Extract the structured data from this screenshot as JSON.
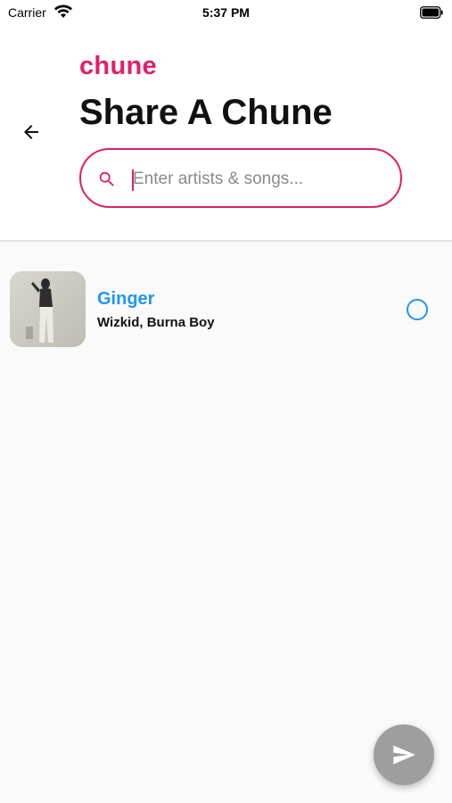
{
  "status_bar": {
    "carrier": "Carrier",
    "time": "5:37 PM"
  },
  "header": {
    "brand": "chune",
    "title": "Share A Chune",
    "back_icon": "arrow-left-icon"
  },
  "search": {
    "value": "",
    "placeholder": "Enter artists & songs...",
    "icon": "search-icon"
  },
  "results": [
    {
      "title": "Ginger",
      "artists": "Wizkid, Burna Boy",
      "selected": false
    }
  ],
  "fab": {
    "icon": "send-icon"
  },
  "colors": {
    "brand": "#e0206a",
    "accent": "#2196f3",
    "fab": "#9e9e9e",
    "background": "#fafafa"
  }
}
